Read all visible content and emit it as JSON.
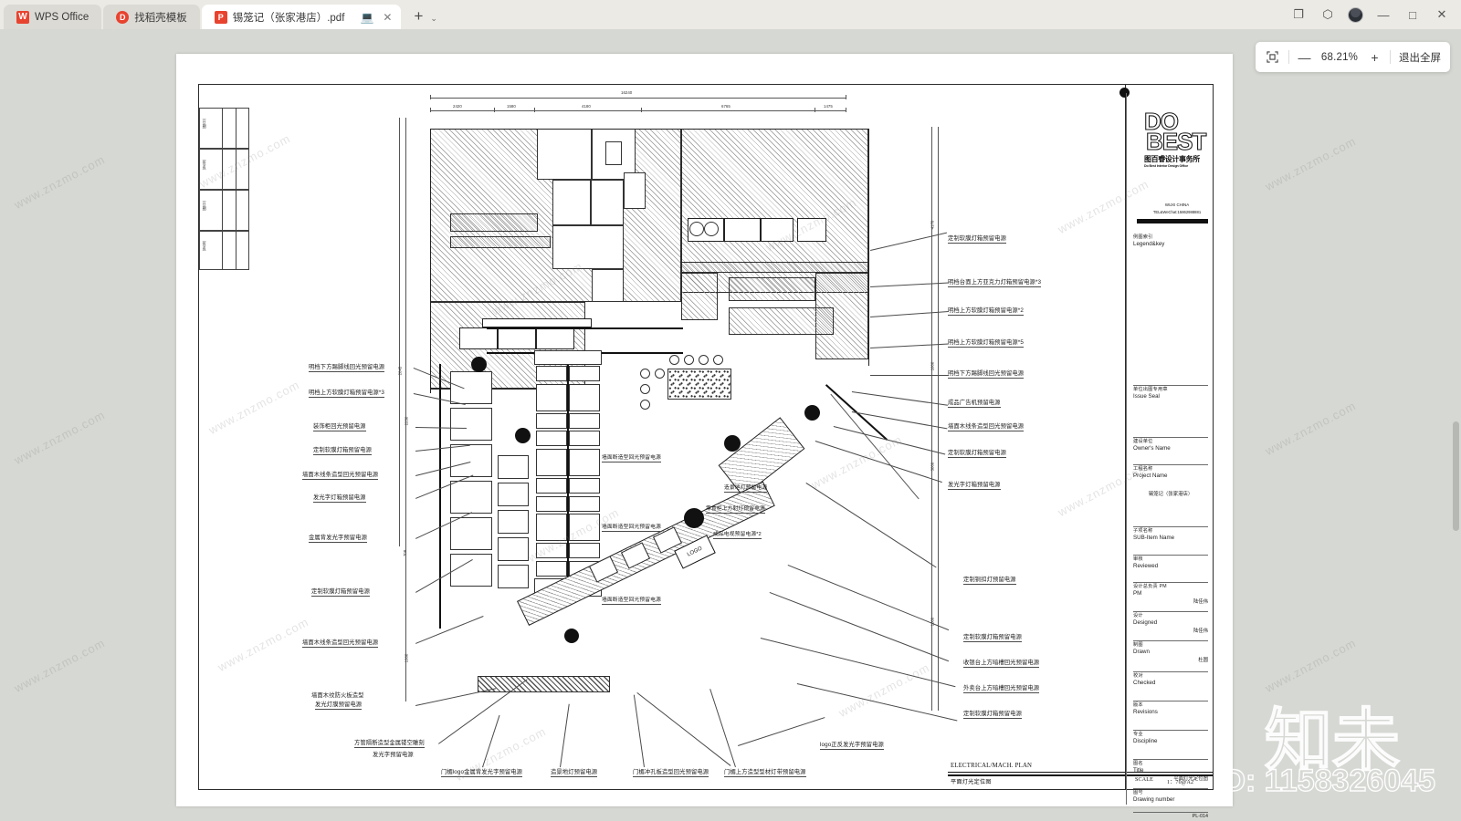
{
  "window": {
    "app_name": "WPS Office",
    "tabs": [
      {
        "label": "WPS Office",
        "icon": "wps-logo-icon"
      },
      {
        "label": "找稻壳模板",
        "icon": "docer-icon"
      },
      {
        "label": "锡笼记（张家港店）.pdf",
        "icon": "pdf-icon"
      }
    ],
    "new_tab_label": "+",
    "tab_menu_label": "⌄",
    "controls": {
      "restore": "❐",
      "cube": "⬡",
      "minimize": "—",
      "maximize": "□",
      "close": "✕"
    }
  },
  "zoom_toolbar": {
    "fit_icon": "fit-to-screen-icon",
    "minus": "—",
    "value": "68.21%",
    "plus": "+",
    "exit_fullscreen": "退出全屏"
  },
  "drawing": {
    "legend_table": [
      {
        "label": "（日期）"
      },
      {
        "label": "（签名）"
      },
      {
        "label": "（日期）"
      },
      {
        "label": "（签名）"
      }
    ],
    "dimensions": {
      "total": "16240",
      "chain": [
        "2420",
        "1580",
        "4180",
        "6765",
        "1475"
      ],
      "vertical": [
        "2645",
        "2250",
        "708",
        "1380",
        "4170",
        "1000",
        "3000",
        "1000"
      ]
    },
    "left_annotations": [
      "明档下方踢脚线回光预留电源",
      "明档上方软膜灯箱预留电源*3",
      "装饰柜回光预留电源",
      "定制软膜灯箱预留电源",
      "墙面木线条造型回光预留电源",
      "发光字灯箱预留电源",
      "金属背发光字预留电源",
      "定制软膜灯箱预留电源",
      "墙面木线条造型回光预留电源",
      "墙面木纹防火板造型",
      "发光灯膜预留电源"
    ],
    "right_annotations": [
      "定制软膜灯箱预留电源",
      "明档台面上方亚克力灯箱预留电源*3",
      "明档上方软膜灯箱预留电源*2",
      "明档上方软膜灯箱预留电源*5",
      "明档下方踢脚线回光预留电源",
      "成品广告机预留电源",
      "墙面木线条造型回光预留电源",
      "定制软膜灯箱预留电源",
      "发光字灯箱预留电源",
      "定制铜扣灯预留电源",
      "定制软膜灯箱预留电源",
      "收银台上方暗槽回光预留电源",
      "外卖台上方暗槽回光预留电源",
      "定制软膜灯箱预留电源"
    ],
    "center_annotations": [
      "墙面断造型回光预留电源",
      "墙面断造型回光预留电源",
      "墙面断造型回光预留电源",
      "造景地灯预留电源",
      "零食柜上方射灯预留电源",
      "成品电视预留电源*2"
    ],
    "bottom_annotations": [
      "方管隔断造型金属镂空雕刻",
      "发光字预留电源",
      "门楣logo金属背发光字预留电源",
      "造景地灯预留电源",
      "门楣冲孔板造型回光预留电源",
      "门楣上方造型型材灯带预留电源",
      "logo正反发光字预留电源"
    ],
    "caption": {
      "title_en": "ELECTRICAL/MACH. PLAN",
      "title_cn": "平面灯光定位图",
      "scale_label": "SCALE",
      "scale_value": "1：70@A2"
    }
  },
  "title_block": {
    "logo": {
      "line1": "DO",
      "line2": "BEST",
      "cn": "图百睿设计事务所",
      "en": "Do Best Interior Design Office"
    },
    "location": "WUXI CHINA",
    "contact": "TEL&WeChat:15862988881",
    "legend_cn": "例图索引",
    "legend_en": "Legend&key",
    "rows": [
      {
        "cn": "单位出图专用章",
        "en": "Issue Seal",
        "value": ""
      },
      {
        "cn": "建设单位",
        "en": "Owner's Name",
        "value": ""
      },
      {
        "cn": "工程名称",
        "en": "Project Name",
        "value": "锡笼记（张家港店）"
      },
      {
        "cn": "子项名称",
        "en": "SUB-Item Name",
        "value": ""
      },
      {
        "cn": "审核",
        "en": "Reviewed",
        "value": ""
      },
      {
        "cn": "设计总负责\nPM",
        "en": "PM",
        "value": "陆佳伟"
      },
      {
        "cn": "设计",
        "en": "Designed",
        "value": "陆佳伟"
      },
      {
        "cn": "制图",
        "en": "Drawn",
        "value": "杜圆"
      },
      {
        "cn": "校对",
        "en": "Checked",
        "value": ""
      },
      {
        "cn": "版本",
        "en": "Revisions",
        "value": ""
      },
      {
        "cn": "专业",
        "en": "Discipline",
        "value": ""
      },
      {
        "cn": "图名",
        "en": "Title",
        "value": "平面灯光定位图"
      },
      {
        "cn": "图号",
        "en": "Drawing number",
        "value": "PL-014"
      }
    ]
  },
  "watermarks": {
    "tiled": "www.znzmo.com",
    "big": "知未",
    "id": "ID: 1158326045"
  }
}
